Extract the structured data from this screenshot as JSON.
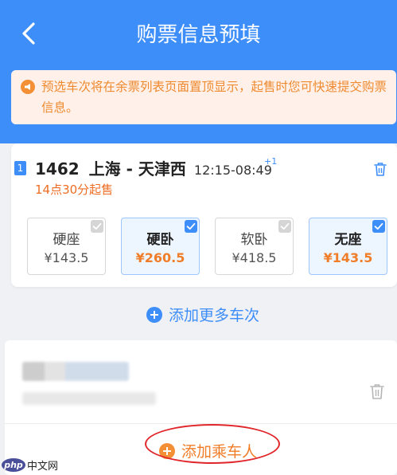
{
  "header": {
    "title": "购票信息预填",
    "back_icon": "chevron-left-icon",
    "color": "#3d8ef8"
  },
  "notice": {
    "icon": "megaphone-icon",
    "text": "预选车次将在余票列表页面置顶显示，起售时您可快速提交购票信息。"
  },
  "train": {
    "badge": "1",
    "number": "1462",
    "route": "上海 - 天津西",
    "time": "12:15-08:49",
    "day_offset": "+1",
    "sale_time": "14点30分起售",
    "delete_icon": "trash-icon",
    "seats": [
      {
        "name": "硬座",
        "price": "¥143.5",
        "selected": false
      },
      {
        "name": "硬卧",
        "price": "¥260.5",
        "selected": true
      },
      {
        "name": "软卧",
        "price": "¥418.5",
        "selected": false
      },
      {
        "name": "无座",
        "price": "¥143.5",
        "selected": true
      }
    ]
  },
  "actions": {
    "add_train": "添加更多车次",
    "add_passenger": "添加乘车人"
  },
  "passenger": {
    "delete_icon": "trash-icon"
  },
  "watermark": {
    "logo": "php",
    "text": "中文网"
  }
}
